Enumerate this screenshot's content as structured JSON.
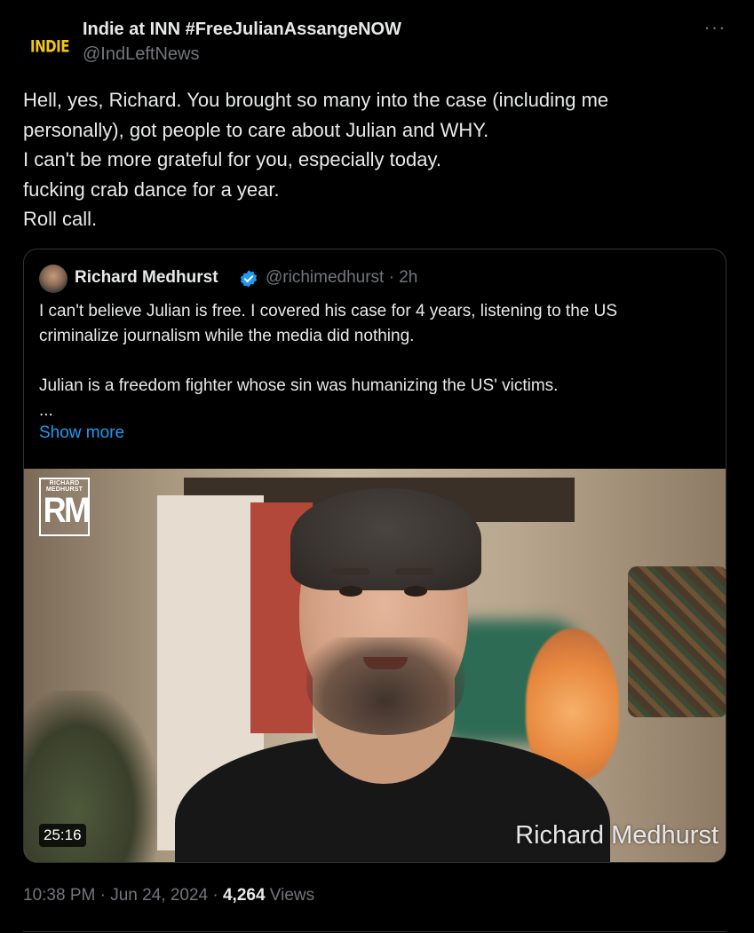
{
  "author": {
    "avatar_text": "INDIE",
    "name": "Indie at INN #FreeJulianAssangeNOW",
    "handle": "@IndLeftNews"
  },
  "more_menu_label": "···",
  "tweet_text_lines": [
    "Hell, yes, Richard. You brought so many into the case (including me",
    "personally), got people to care about Julian and WHY.",
    "I can't be more grateful for you, especially today.",
    "fucking crab dance for a year.",
    "Roll call."
  ],
  "quoted": {
    "name": "Richard Medhurst",
    "verified": true,
    "handle_time": "@richimedhurst · 2h",
    "text_lines": [
      "I can't believe Julian is free. I covered his case for 4 years, listening to the US",
      "criminalize journalism while the media did nothing.",
      "",
      "Julian is a freedom fighter whose sin was humanizing the US' victims.",
      "..."
    ],
    "show_more": "Show more",
    "video": {
      "logo_small": "RICHARD MEDHURST",
      "logo_big": "RM",
      "duration": "25:16",
      "caption": "Richard Medhurst"
    }
  },
  "footer": {
    "time_date": "10:38 PM · Jun 24, 2024 · ",
    "views_count": "4,264",
    "views_label": " Views"
  },
  "colors": {
    "background": "#000000",
    "text": "#e7e9ea",
    "muted": "#71767b",
    "link": "#1d9bf0",
    "border": "#2f3336",
    "verified": "#1d9bf0"
  }
}
